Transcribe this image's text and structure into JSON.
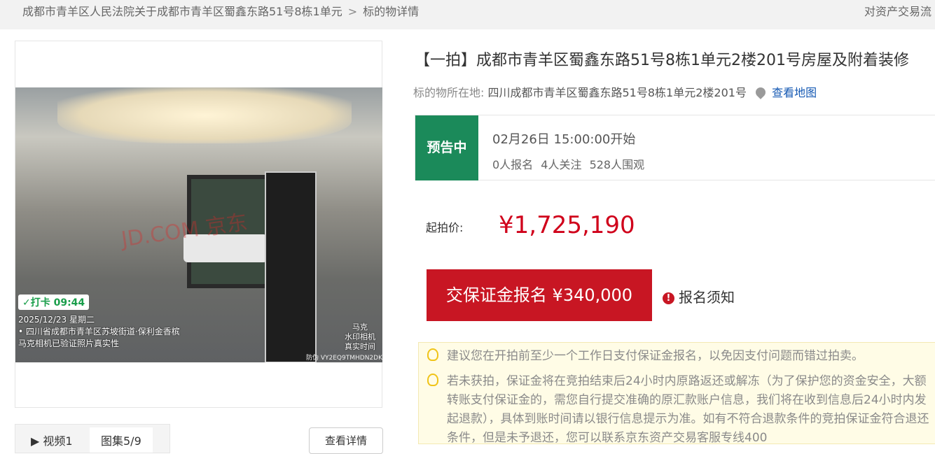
{
  "breadcrumb": {
    "court": "成都市青羊区人民法院关于成都市青羊区蜀鑫东路51号8栋1单元",
    "separator": ">",
    "current": "标的物详情"
  },
  "top_link": "对资产交易流",
  "gallery": {
    "photo_watermark": "JD.COM 京东",
    "clock_badge": "✓打卡 09:44",
    "photo_date": "2025/12/23 星期二",
    "photo_location": "• 四川省成都市青羊区苏坡街道·保利金香槟",
    "photo_verified": "马克相机已验证照片真实性",
    "brand_lines": [
      "马克",
      "水印相机",
      "真实时间"
    ],
    "anti_fake_code": "防伪 VY2EQ9TMHDN2DK",
    "tab_video": "▶ 视频1",
    "tab_images": "图集5/9",
    "detail_button": "查看详情"
  },
  "item": {
    "title": "【一拍】成都市青羊区蜀鑫东路51号8栋1单元2楼201号房屋及附着装修",
    "location_label": "标的物所在地:",
    "location_value": "四川成都市青羊区蜀鑫东路51号8栋1单元2楼201号",
    "map_link": "查看地图",
    "status_badge": "预告中",
    "start_time": "02月26日 15:00:00开始",
    "stats": [
      "0人报名",
      "4人关注",
      "528人围观"
    ],
    "price_label": "起拍价:",
    "price_value": "¥1,725,190",
    "deposit_button": "交保证金报名 ¥340,000",
    "notice_link": "报名须知",
    "notice_icon": "!",
    "tips": [
      "建议您在开拍前至少一个工作日支付保证金报名，以免因支付问题而错过拍卖。",
      "若未获拍，保证金将在竞拍结束后24小时内原路返还或解冻（为了保护您的资金安全，大额转账支付保证金的，需您自行提交准确的原汇款账户信息，我们将在收到信息后24小时内发起退款），具体到账时间请以银行信息提示为准。如有不符合退款条件的竞拍保证金符合退还条件，但是未予退还，您可以联系京东资产交易客服专线400"
    ]
  },
  "colors": {
    "status_green": "#1b8a5a",
    "price_red": "#d0021b",
    "button_red": "#c81623",
    "link_blue": "#1559b3"
  }
}
